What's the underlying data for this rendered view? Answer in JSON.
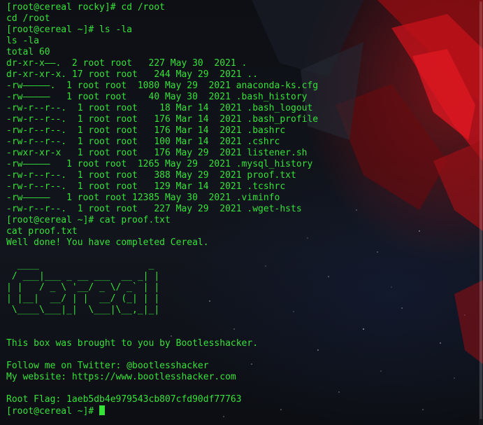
{
  "terminal": {
    "text_color": "#36e23a",
    "lines": [
      "[root@cereal rocky]# cd /root",
      "cd /root",
      "[root@cereal ~]# ls -la",
      "ls -la",
      "total 60",
      "dr-xr-x——.  2 root root   227 May 30  2021 .",
      "dr-xr-xr-x. 17 root root   244 May 29  2021 ..",
      "-rw—————.  1 root root  1080 May 29  2021 anaconda-ks.cfg",
      "-rw—————   1 root root    40 May 30  2021 .bash_history",
      "-rw-r--r--.  1 root root    18 Mar 14  2021 .bash_logout",
      "-rw-r--r--.  1 root root   176 Mar 14  2021 .bash_profile",
      "-rw-r--r--.  1 root root   176 Mar 14  2021 .bashrc",
      "-rw-r--r--.  1 root root   100 Mar 14  2021 .cshrc",
      "-rwxr-xr-x   1 root root   176 May 29  2021 listener.sh",
      "-rw—————   1 root root  1265 May 29  2021 .mysql_history",
      "-rw-r--r--.  1 root root   388 May 29  2021 proof.txt",
      "-rw-r--r--.  1 root root   129 Mar 14  2021 .tcshrc",
      "-rw—————   1 root root 12385 May 30  2021 .viminfo",
      "-rw-r--r--.  1 root root   227 May 29  2021 .wget-hsts",
      "[root@cereal ~]# cat proof.txt",
      "cat proof.txt",
      "Well done! You have completed Cereal.",
      "",
      "  ____                    _",
      " / ___|___ _ __ ___  __ _| |",
      "| |   / _ \\ '__/ _ \\/ _` | |",
      "| |__|  __/ | |  __/ (_| | |",
      " \\____\\___|_|  \\___|\\__,_|_|",
      "",
      "",
      "This box was brought to you by Bootlesshacker.",
      "",
      "Follow me on Twitter: @bootlesshacker",
      "My website: https://www.bootlesshacker.com",
      "",
      "Root Flag: 1aeb5db4e979543cb807cfd90df77763"
    ],
    "prompt": "[root@cereal ~]# "
  }
}
